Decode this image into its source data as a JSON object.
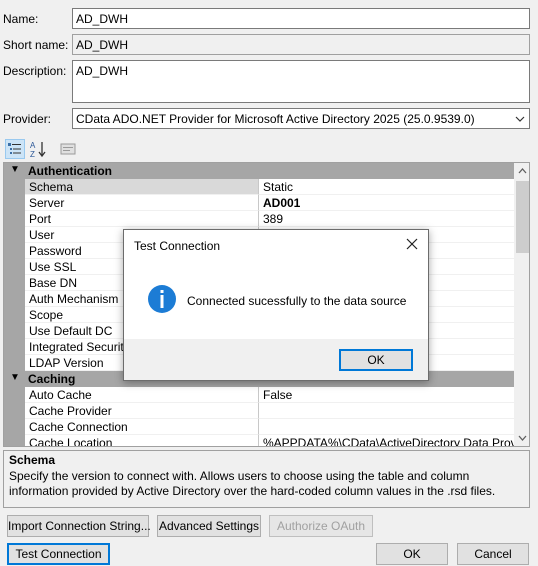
{
  "form": {
    "name_label": "Name:",
    "name_value": "AD_DWH",
    "short_name_label": "Short name:",
    "short_name_value": "AD_DWH",
    "description_label": "Description:",
    "description_value": "AD_DWH",
    "provider_label": "Provider:",
    "provider_value": "CData ADO.NET Provider for Microsoft Active Directory 2025 (25.0.9539.0)"
  },
  "toolbar": {
    "categorized_icon": "categorized-view-icon",
    "alphabetical_icon": "alphabetical-sort-icon",
    "property_pages_icon": "property-pages-icon"
  },
  "grid": {
    "categories": [
      {
        "title": "Authentication",
        "toggle": "▼"
      },
      {
        "title": "Caching",
        "toggle": "▼"
      }
    ],
    "auth_rows": [
      {
        "name": "Schema",
        "value": "Static"
      },
      {
        "name": "Server",
        "value": "AD001"
      },
      {
        "name": "Port",
        "value": "389"
      },
      {
        "name": "User",
        "value": ""
      },
      {
        "name": "Password",
        "value": ""
      },
      {
        "name": "Use SSL",
        "value": ""
      },
      {
        "name": "Base DN",
        "value": ""
      },
      {
        "name": "Auth Mechanism",
        "value": ""
      },
      {
        "name": "Scope",
        "value": ""
      },
      {
        "name": "Use Default DC",
        "value": ""
      },
      {
        "name": "Integrated Security",
        "value": ""
      },
      {
        "name": "LDAP Version",
        "value": ""
      }
    ],
    "caching_rows": [
      {
        "name": "Auto Cache",
        "value": "False"
      },
      {
        "name": "Cache Provider",
        "value": ""
      },
      {
        "name": "Cache Connection",
        "value": ""
      },
      {
        "name": "Cache Location",
        "value": "%APPDATA%\\CData\\ActiveDirectory Data Provider"
      }
    ]
  },
  "description": {
    "title": "Schema",
    "text": "Specify the version to connect with. Allows users to choose using the table and column information provided by Active Directory over the hard-coded column values in the .rsd files."
  },
  "buttons": {
    "import": "Import Connection String...",
    "advanced": "Advanced Settings",
    "authorize": "Authorize OAuth",
    "test": "Test Connection",
    "ok": "OK",
    "cancel": "Cancel"
  },
  "dialog": {
    "title": "Test Connection",
    "message": "Connected sucessfully to the data source",
    "ok": "OK",
    "icon": "info-icon",
    "info_color": "#1c7cd5"
  }
}
